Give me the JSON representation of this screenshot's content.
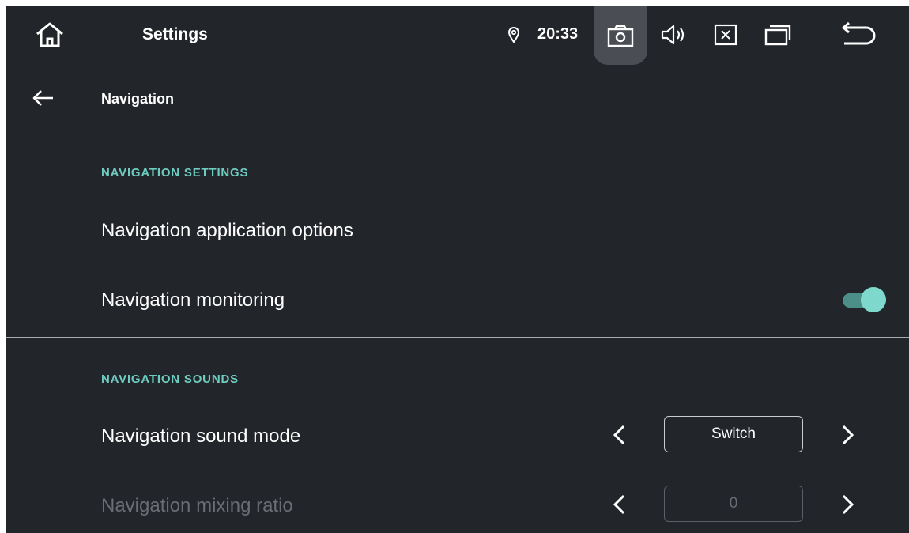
{
  "status_bar": {
    "app_title": "Settings",
    "time": "20:33",
    "icons": [
      "home-icon",
      "location-icon",
      "camera-icon",
      "volume-icon",
      "close-box-icon",
      "recents-icon",
      "back-icon"
    ]
  },
  "header": {
    "title": "Navigation"
  },
  "sections": [
    {
      "title": "NAVIGATION SETTINGS",
      "items": [
        {
          "label": "Navigation application options"
        },
        {
          "label": "Navigation monitoring",
          "toggle": true
        }
      ]
    },
    {
      "title": "NAVIGATION SOUNDS",
      "items": [
        {
          "label": "Navigation sound mode",
          "value": "Switch",
          "enabled": true
        },
        {
          "label": "Navigation mixing ratio",
          "value": "0",
          "enabled": false
        }
      ]
    }
  ],
  "colors": {
    "background": "#22252a",
    "accent": "#6ecbc0",
    "toggle_thumb": "#7fd8cc",
    "toggle_track": "#4c8f89",
    "disabled_text": "#6a6e74"
  }
}
